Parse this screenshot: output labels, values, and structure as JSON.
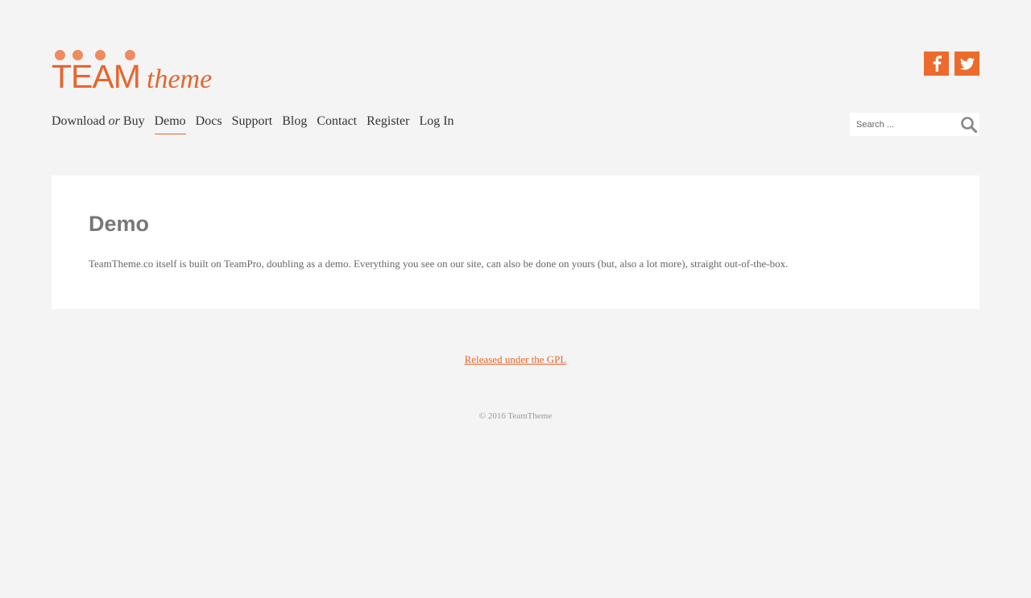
{
  "brand": {
    "team": "TEAM",
    "theme": "theme",
    "color": "#e8652d",
    "dot_color": "#f08a5f"
  },
  "social": [
    {
      "icon": "facebook-icon",
      "label": "f"
    },
    {
      "icon": "twitter-icon"
    }
  ],
  "nav": {
    "items": [
      {
        "label_pre": "Download",
        "label_em": "or",
        "label_post": "Buy"
      },
      {
        "label": "Demo",
        "active": true
      },
      {
        "label": "Docs"
      },
      {
        "label": "Support"
      },
      {
        "label": "Blog"
      },
      {
        "label": "Contact"
      },
      {
        "label": "Register"
      },
      {
        "label": "Log In"
      }
    ]
  },
  "search": {
    "placeholder": "Search ...",
    "icon": "search-icon"
  },
  "main": {
    "title": "Demo",
    "body": "TeamTheme.co itself is built on TeamPro, doubling as a demo. Everything you see on our site, can also be done on yours (but, also a lot more), straight out-of-the-box."
  },
  "footer": {
    "gpl_link": "Released under the GPL",
    "copyright": "© 2016 TeamTheme"
  },
  "colors": {
    "background": "#f4f4f4",
    "accent": "#e8652d",
    "card": "#ffffff"
  }
}
